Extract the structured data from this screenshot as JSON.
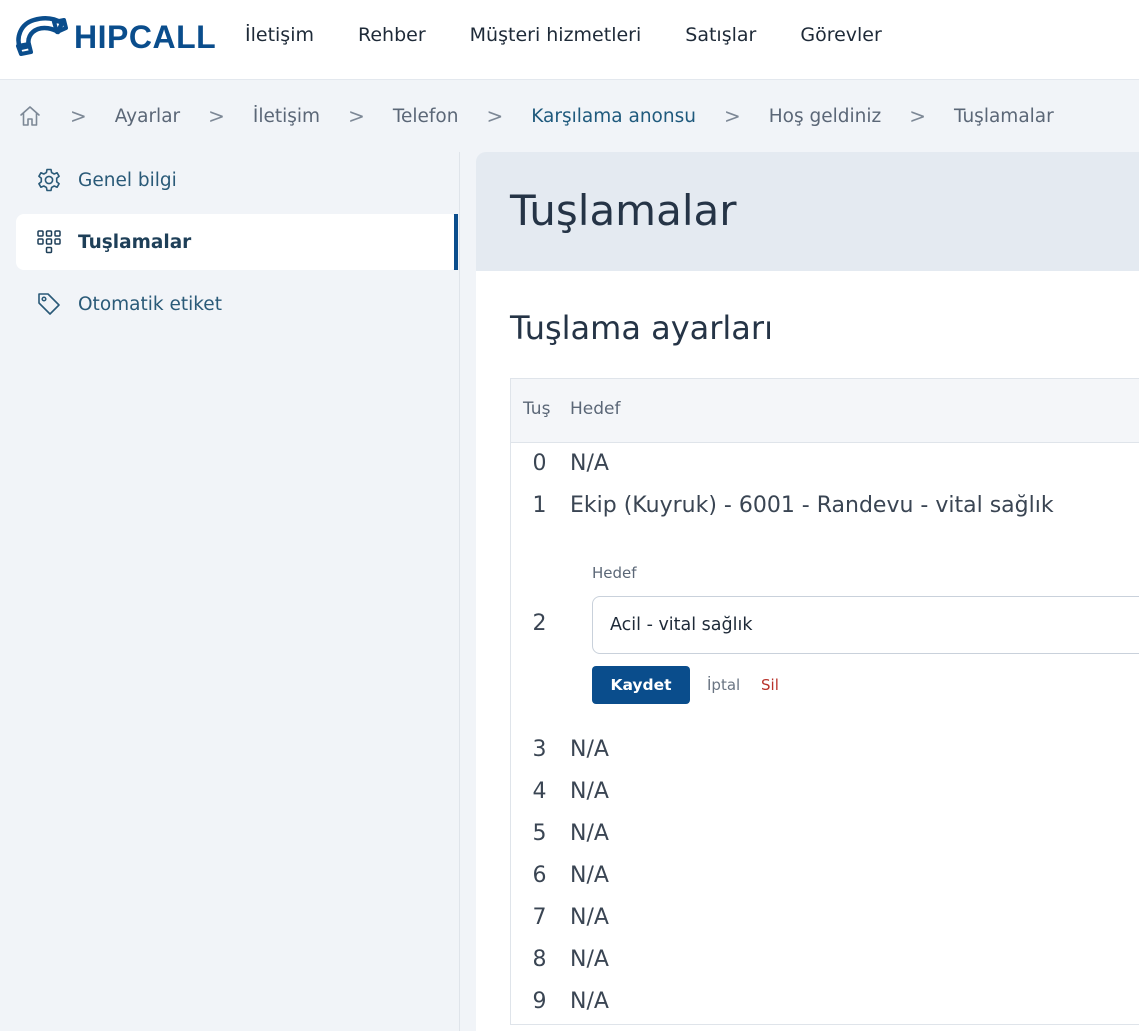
{
  "brand": {
    "name": "HIPCALL",
    "color": "#0a4d8c",
    "icon": "phone-handset-icon"
  },
  "nav": {
    "items": [
      "İletişim",
      "Rehber",
      "Müşteri hizmetleri",
      "Satışlar",
      "Görevler"
    ]
  },
  "breadcrumb": {
    "home_icon": "home-icon",
    "separator": ">",
    "items": [
      "Ayarlar",
      "İletişim",
      "Telefon",
      "Karşılama anonsu",
      "Hoş geldiniz",
      "Tuşlamalar"
    ],
    "active_index": 3
  },
  "sidebar": {
    "items": [
      {
        "label": "Genel bilgi",
        "icon": "gear-icon",
        "active": false
      },
      {
        "label": "Tuşlamalar",
        "icon": "keypad-icon",
        "active": true
      },
      {
        "label": "Otomatik etiket",
        "icon": "tag-icon",
        "active": false
      }
    ]
  },
  "page": {
    "title": "Tuşlamalar",
    "section_title": "Tuşlama ayarları"
  },
  "table": {
    "headers": {
      "key": "Tuş",
      "target": "Hedef"
    },
    "rows": [
      {
        "key": "0",
        "target": "N/A"
      },
      {
        "key": "1",
        "target": "Ekip (Kuyruk) - 6001 - Randevu - vital sağlık"
      },
      {
        "key": "2",
        "editing": true
      },
      {
        "key": "3",
        "target": "N/A"
      },
      {
        "key": "4",
        "target": "N/A"
      },
      {
        "key": "5",
        "target": "N/A"
      },
      {
        "key": "6",
        "target": "N/A"
      },
      {
        "key": "7",
        "target": "N/A"
      },
      {
        "key": "8",
        "target": "N/A"
      },
      {
        "key": "9",
        "target": "N/A"
      }
    ]
  },
  "edit": {
    "key": "2",
    "field_label": "Hedef",
    "field_value": "Acil - vital sağlık",
    "save_label": "Kaydet",
    "cancel_label": "İptal",
    "delete_label": "Sil"
  },
  "colors": {
    "primary": "#0a4d8c",
    "danger": "#b8322a",
    "header_bg": "#e4eaf1",
    "page_bg": "#f1f4f8"
  }
}
